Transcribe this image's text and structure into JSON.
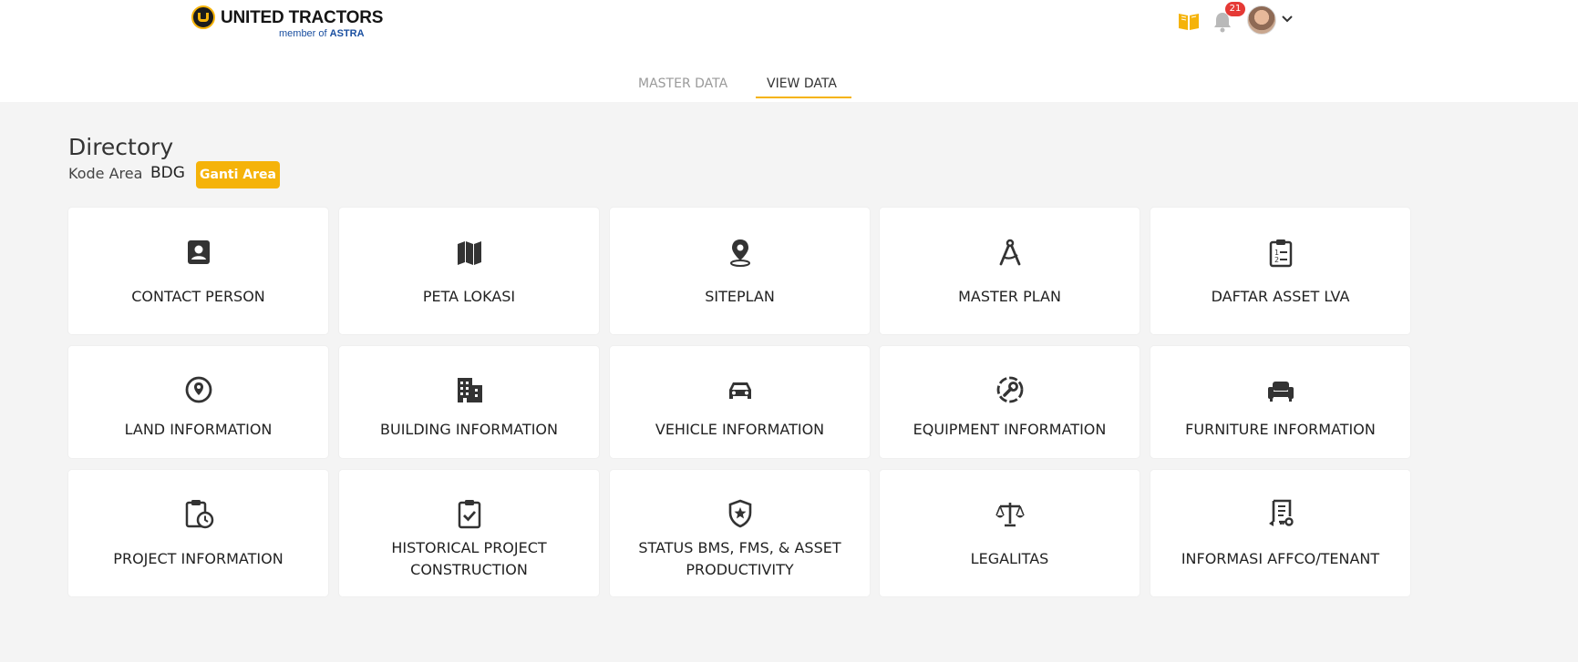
{
  "header": {
    "brand": "UNITED TRACTORS",
    "tagline_prefix": "member of",
    "tagline_brand": "ASTRA",
    "notification_count": "21"
  },
  "tabs": [
    {
      "label": "MASTER DATA",
      "active": false
    },
    {
      "label": "VIEW DATA",
      "active": true
    }
  ],
  "page": {
    "title": "Directory",
    "area_label": "Kode Area",
    "area_code": "BDG",
    "change_area_button": "Ganti Area"
  },
  "cards": [
    {
      "label": "CONTACT PERSON",
      "icon": "contact-card-icon"
    },
    {
      "label": "PETA LOKASI",
      "icon": "map-icon"
    },
    {
      "label": "SITEPLAN",
      "icon": "map-pin-icon"
    },
    {
      "label": "MASTER PLAN",
      "icon": "compass-drafting-icon"
    },
    {
      "label": "DAFTAR ASSET LVA",
      "icon": "clipboard-list-icon"
    },
    {
      "label": "LAND INFORMATION",
      "icon": "location-circle-icon"
    },
    {
      "label": "BUILDING INFORMATION",
      "icon": "building-icon"
    },
    {
      "label": "VEHICLE INFORMATION",
      "icon": "car-icon"
    },
    {
      "label": "EQUIPMENT INFORMATION",
      "icon": "wrench-gear-icon"
    },
    {
      "label": "FURNITURE INFORMATION",
      "icon": "couch-icon"
    },
    {
      "label": "PROJECT INFORMATION",
      "icon": "clipboard-clock-icon"
    },
    {
      "label_line1": "HISTORICAL PROJECT",
      "label_line2": "CONSTRUCTION",
      "icon": "clipboard-check-icon"
    },
    {
      "label_line1": "STATUS BMS, FMS, & ASSET",
      "label_line2": "PRODUCTIVITY",
      "icon": "shield-star-icon"
    },
    {
      "label": "LEGALITAS",
      "icon": "scale-icon"
    },
    {
      "label": "INFORMASI AFFCO/TENANT",
      "icon": "document-key-icon"
    }
  ],
  "colors": {
    "accent": "#f5b30a",
    "background": "#f4f4f4",
    "card": "#ffffff",
    "icon": "#333333",
    "badge": "#e53935",
    "tagline": "#1a4fa0"
  }
}
